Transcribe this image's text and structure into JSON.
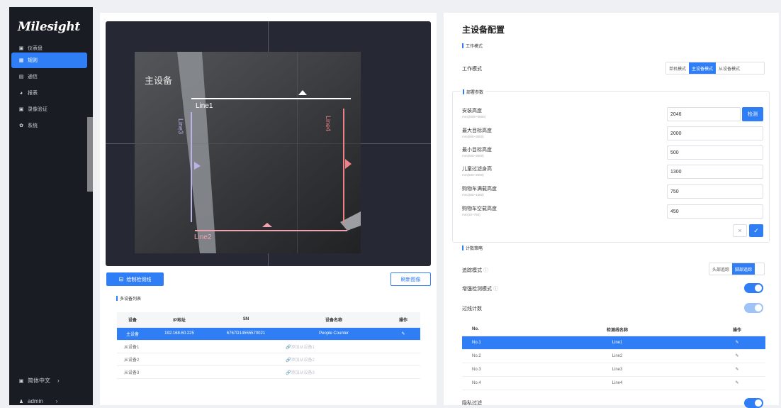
{
  "sidebar": {
    "logo": "Milesight",
    "items": [
      {
        "label": "仪表盘",
        "icon": "dashboard-icon"
      },
      {
        "label": "规则",
        "icon": "rules-icon"
      },
      {
        "label": "通信",
        "icon": "communication-icon"
      },
      {
        "label": "报表",
        "icon": "report-icon"
      },
      {
        "label": "录像验证",
        "icon": "video-verify-icon"
      },
      {
        "label": "系统",
        "icon": "system-icon"
      }
    ],
    "language": "简体中文",
    "user": "admin"
  },
  "video": {
    "overlay_label": "主设备",
    "lines": [
      "Line1",
      "Line2",
      "Line3",
      "Line4"
    ]
  },
  "left": {
    "draw_button": "绘制检测线",
    "refresh_button": "刷新图像",
    "device_list_title": "多设备列表",
    "table": {
      "headers": [
        "设备",
        "IP地址",
        "SN",
        "设备名称",
        "操作"
      ],
      "rows": [
        {
          "device": "主设备",
          "ip": "192.168.60.225",
          "sn": "6767D14555570021",
          "name": "People Counter"
        },
        {
          "device": "从设备1",
          "link": "添加从设备1"
        },
        {
          "device": "从设备2",
          "link": "添加从设备2"
        },
        {
          "device": "从设备3",
          "link": "添加从设备3"
        }
      ]
    }
  },
  "right": {
    "title": "主设备配置",
    "work_mode_section": "工作模式",
    "work_mode_label": "工作模式",
    "work_modes": [
      "单机模式",
      "主设备模式",
      "从设备模式"
    ],
    "deploy_section": "部署参数",
    "params": [
      {
        "label": "安装高度",
        "range": "mm(2000~3500)",
        "value": "2046"
      },
      {
        "label": "最大目标高度",
        "range": "mm(500~3000)",
        "value": "2000"
      },
      {
        "label": "最小目标高度",
        "range": "mm(500~3000)",
        "value": "500"
      },
      {
        "label": "儿童过滤身高",
        "range": "mm(500~3000)",
        "value": "1300"
      },
      {
        "label": "购物车满载高度",
        "range": "mm(300~1500)",
        "value": "750"
      },
      {
        "label": "购物车空载高度",
        "range": "mm(10~750)",
        "value": "450"
      }
    ],
    "detect_button": "检测",
    "cancel_icon": "close-icon",
    "confirm_icon": "check-icon",
    "count_section": "计数策略",
    "track_mode_label": "追踪模式",
    "track_modes": [
      "头部追踪",
      "脚部追踪"
    ],
    "enhance_label": "增强检测模式",
    "crossline_label": "过线计数",
    "line_table": {
      "headers": [
        "No.",
        "检测线名称",
        "操作"
      ],
      "rows": [
        {
          "no": "No.1",
          "name": "Line1"
        },
        {
          "no": "No.2",
          "name": "Line2"
        },
        {
          "no": "No.3",
          "name": "Line3"
        },
        {
          "no": "No.4",
          "name": "Line4"
        }
      ]
    },
    "cutoff_label": "隐私过滤"
  }
}
